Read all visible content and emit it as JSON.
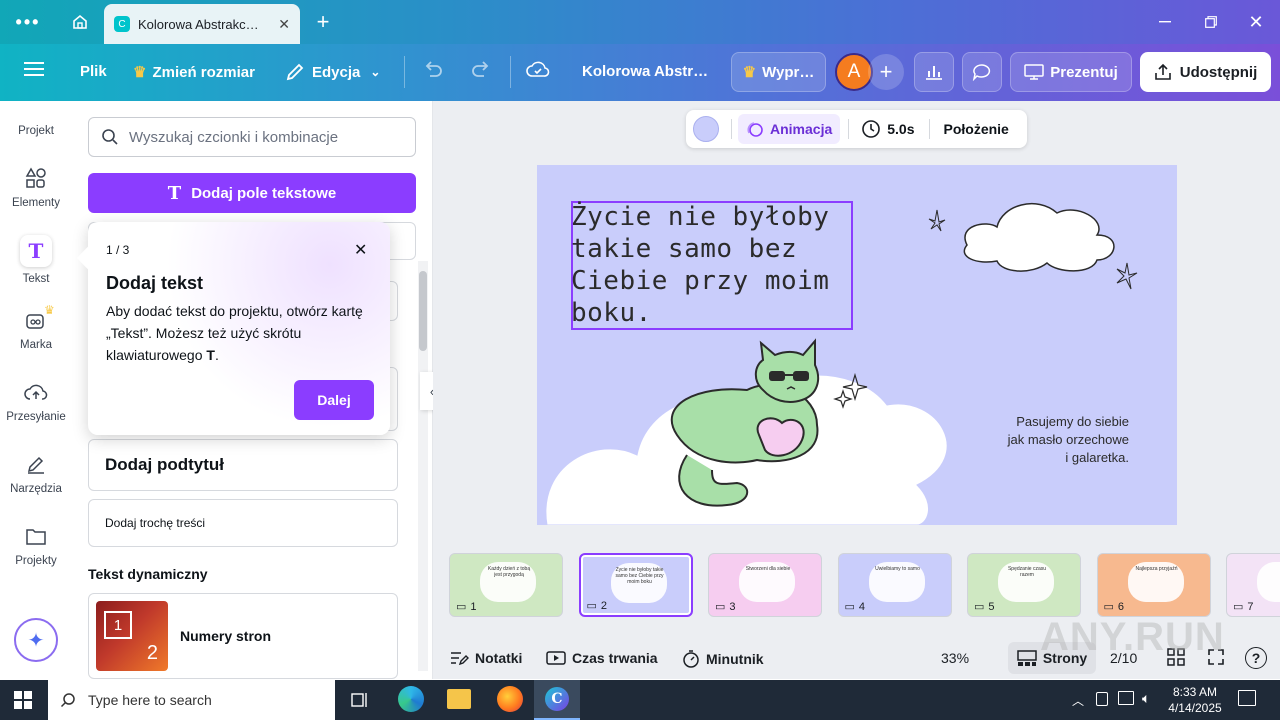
{
  "browser": {
    "tab_title": "Kolorowa Abstrakc…",
    "new_tab": "+"
  },
  "header": {
    "menu_icon": "hamburger-icon",
    "file": "Plik",
    "resize": "Zmień rozmiar",
    "editing": "Edycja",
    "doc_title": "Kolorowa Abstr…",
    "pro_label": "Wypr…",
    "avatar_letter": "A",
    "present": "Prezentuj",
    "share": "Udostępnij"
  },
  "rail": {
    "items": [
      {
        "label": "Projekt"
      },
      {
        "label": "Elementy"
      },
      {
        "label": "Tekst"
      },
      {
        "label": "Marka"
      },
      {
        "label": "Przesyłanie"
      },
      {
        "label": "Narzędzia"
      },
      {
        "label": "Projekty"
      }
    ]
  },
  "panel": {
    "search_placeholder": "Wyszukaj czcionki i kombinacje",
    "add_textbox": "Dodaj pole tekstowe",
    "subtitle_card": "Dodaj podtytuł",
    "body_card": "Dodaj trochę treści",
    "dynamic_heading": "Tekst dynamiczny",
    "page_numbers": "Numery stron",
    "page_numbers_thumb_1": "1",
    "page_numbers_thumb_2": "2",
    "partial_letter": "D"
  },
  "tooltip": {
    "step": "1 / 3",
    "title": "Dodaj tekst",
    "body_1": "Aby dodać tekst do projektu, otwórz kartę „Tekst”. Możesz też użyć skrótu klawiaturowego ",
    "body_key": "T",
    "body_end": ".",
    "next": "Dalej"
  },
  "toolbar": {
    "animation": "Animacja",
    "duration": "5.0s",
    "position": "Położenie"
  },
  "slide": {
    "headline": "Życie nie byłoby takie samo bez Ciebie przy moim boku.",
    "side_text_1": "Pasujemy do siebie",
    "side_text_2": "jak masło orzechowe",
    "side_text_3": "i galaretka."
  },
  "thumbnails": [
    {
      "num": "1",
      "bg": "#cfe8c2",
      "text": "Każdy dzień z tobą jest przygodą"
    },
    {
      "num": "2",
      "bg": "#c9cdfb",
      "text": "Życie nie byłoby takie samo bez Ciebie przy moim boku"
    },
    {
      "num": "3",
      "bg": "#f6cdf0",
      "text": "Stworzeni dla siebie"
    },
    {
      "num": "4",
      "bg": "#c9cdfb",
      "text": "Uwielbiamy to samo"
    },
    {
      "num": "5",
      "bg": "#cfe8c2",
      "text": "Spędzanie czasu razem"
    },
    {
      "num": "6",
      "bg": "#f7b98f",
      "text": "Najlepsza przyjaźń"
    },
    {
      "num": "7",
      "bg": "#f3e3f6",
      "text": ""
    }
  ],
  "bottombar": {
    "notes": "Notatki",
    "duration": "Czas trwania",
    "timer": "Minutnik",
    "zoom": "33%",
    "pages": "Strony",
    "page_count": "2/10"
  },
  "taskbar": {
    "search_placeholder": "Type here to search",
    "time": "8:33 AM",
    "date": "4/14/2025"
  },
  "watermark": "ANY.RUN",
  "colors": {
    "accent": "#8b3dff",
    "slide_bg": "#c9cdfb",
    "cat": "#a8dfa8"
  }
}
